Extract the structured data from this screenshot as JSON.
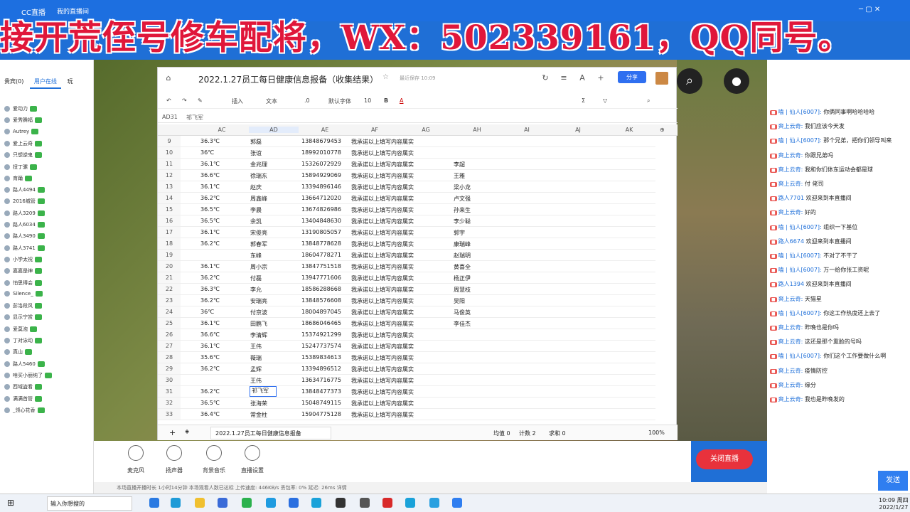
{
  "app": {
    "title": "CC直播",
    "tab1": "我的直播间",
    "banner": "接开荒侄号修车配将，WX：502339161，QQ同号。"
  },
  "left_panel": {
    "tabs": [
      "贵宾(0)",
      "用户在线",
      "玩"
    ],
    "users": [
      "爱动力",
      "爱秀腾福",
      "Autrey",
      "爱上云奇",
      "只想逆鬼",
      "扭丁骡",
      "育踊",
      "路人4494",
      "2016城管",
      "路人3209",
      "路人6034",
      "路人3490",
      "路人3741",
      "小学太祝",
      "嘉嘉是神",
      "怕思得会",
      "Silence_",
      "彭洛段风",
      "显示宁赏",
      "爱莫泡",
      "丁对泳动",
      "真山",
      "路人5460",
      "啥买小丽纯了",
      "西域盗看",
      "满满首管",
      "_领心花香"
    ]
  },
  "sheet": {
    "title": "2022.1.27员工每日健康信息报备（收集结果）",
    "share": "分享",
    "saved": "最近保存 10:09",
    "cell_ref": "AD31",
    "formula": "祁飞军",
    "toolbar": [
      "插入",
      "文本",
      ".0",
      "默认字体",
      "10",
      "B",
      "A"
    ],
    "columns": [
      "AC",
      "AD",
      "AE",
      "AF",
      "AG",
      "AH",
      "AI",
      "AJ",
      "AK"
    ],
    "rows": [
      {
        "n": "9",
        "temp": "36.3℃",
        "name": "郭磊",
        "phone": "13848679453",
        "note": "我承诺以上填写内容属实",
        "ah": ""
      },
      {
        "n": "10",
        "temp": "36℃",
        "name": "张谊",
        "phone": "18992010778",
        "note": "我承诺以上填写内容属实",
        "ah": ""
      },
      {
        "n": "11",
        "temp": "36.1℃",
        "name": "金兆理",
        "phone": "15326072929",
        "note": "我承诺以上填写内容属实",
        "ah": "李超"
      },
      {
        "n": "12",
        "temp": "36.6℃",
        "name": "徐瑞东",
        "phone": "15894929069",
        "note": "我承诺以上填写内容属实",
        "ah": "王雅"
      },
      {
        "n": "13",
        "temp": "36.1℃",
        "name": "赵庆",
        "phone": "13394896146",
        "note": "我承诺以上填写内容属实",
        "ah": "梁小龙"
      },
      {
        "n": "14",
        "temp": "36.2℃",
        "name": "周鑫峰",
        "phone": "13664712020",
        "note": "我承诺以上填写内容属实",
        "ah": "卢文强"
      },
      {
        "n": "15",
        "temp": "36.5℃",
        "name": "李晨",
        "phone": "13674826986",
        "note": "我承诺以上填写内容属实",
        "ah": "孙来生"
      },
      {
        "n": "16",
        "temp": "36.5℃",
        "name": "余凯",
        "phone": "13404848630",
        "note": "我承诺以上填写内容属实",
        "ah": "李少聪"
      },
      {
        "n": "17",
        "temp": "36.1℃",
        "name": "宋俊亮",
        "phone": "13190805057",
        "note": "我承诺以上填写内容属实",
        "ah": "郭宇"
      },
      {
        "n": "18",
        "temp": "36.2℃",
        "name": "郭春军",
        "phone": "13848778628",
        "note": "我承诺以上填写内容属实",
        "ah": "康瑞峰"
      },
      {
        "n": "19",
        "temp": "",
        "name": "东峰",
        "phone": "18604778271",
        "note": "我承诺以上填写内容属实",
        "ah": "赵瑞明"
      },
      {
        "n": "20",
        "temp": "36.1℃",
        "name": "周小宗",
        "phone": "13847751518",
        "note": "我承诺以上填写内容属实",
        "ah": "黄喜全"
      },
      {
        "n": "21",
        "temp": "36.2℃",
        "name": "付磊",
        "phone": "13947771606",
        "note": "我承诺以上填写内容属实",
        "ah": "杨正伊"
      },
      {
        "n": "22",
        "temp": "36.3℃",
        "name": "李允",
        "phone": "18586288668",
        "note": "我承诺以上填写内容属实",
        "ah": "周慧枝"
      },
      {
        "n": "23",
        "temp": "36.2℃",
        "name": "安瑞亮",
        "phone": "13848576608",
        "note": "我承诺以上填写内容属实",
        "ah": "吴阳"
      },
      {
        "n": "24",
        "temp": "36℃",
        "name": "付京波",
        "phone": "18004897045",
        "note": "我承诺以上填写内容属实",
        "ah": "马俊英"
      },
      {
        "n": "25",
        "temp": "36.1℃",
        "name": "田鹏飞",
        "phone": "18686046465",
        "note": "我承诺以上填写内容属实",
        "ah": "李佳杰"
      },
      {
        "n": "26",
        "temp": "36.6℃",
        "name": "李清辉",
        "phone": "15374921299",
        "note": "我承诺以上填写内容属实",
        "ah": ""
      },
      {
        "n": "27",
        "temp": "36.1℃",
        "name": "王伟",
        "phone": "15247737574",
        "note": "我承诺以上填写内容属实",
        "ah": ""
      },
      {
        "n": "28",
        "temp": "35.6℃",
        "name": "薇瑞",
        "phone": "15389834613",
        "note": "我承诺以上填写内容属实",
        "ah": ""
      },
      {
        "n": "29",
        "temp": "36.2℃",
        "name": "孟辉",
        "phone": "13394896512",
        "note": "我承诺以上填写内容属实",
        "ah": ""
      },
      {
        "n": "30",
        "temp": "",
        "name": "王伟",
        "phone": "13634716775",
        "note": "我承诺以上填写内容属实",
        "ah": ""
      },
      {
        "n": "31",
        "temp": "36.2℃",
        "name": "祁飞军",
        "phone": "13848477373",
        "note": "我承诺以上填写内容属实",
        "ah": ""
      },
      {
        "n": "32",
        "temp": "36.5℃",
        "name": "张海荣",
        "phone": "15048749115",
        "note": "我承诺以上填写内容属实",
        "ah": ""
      },
      {
        "n": "33",
        "temp": "36.4℃",
        "name": "常金柱",
        "phone": "15904775128",
        "note": "我承诺以上填写内容属实",
        "ah": ""
      }
    ],
    "sheet_tab": "2022.1.27员工每日健康信息报备",
    "bottom_stats": [
      "均值 0",
      "计数 2",
      "求和 0"
    ],
    "zoom": "100%"
  },
  "chat": {
    "messages": [
      {
        "user": "嗑 | 仙人[6007]:",
        "text": "你俩同事啊哈哈哈哈"
      },
      {
        "user": "爽上云奇:",
        "text": "我们应该今天发"
      },
      {
        "user": "嗑 | 仙人[6007]:",
        "text": "那个兄弟，把你们领导叫来"
      },
      {
        "user": "爽上云奇:",
        "text": "你跟兄弟吗"
      },
      {
        "user": "爽上云奇:",
        "text": "我和你们体东运动会都是球"
      },
      {
        "user": "爽上云奇:",
        "text": "付 佬司"
      },
      {
        "user": "路人7701",
        "text": "欢迎来到本直播间"
      },
      {
        "user": "爽上云奇:",
        "text": "好的"
      },
      {
        "user": "嗑 | 仙人[6007]:",
        "text": "组织一下基位"
      },
      {
        "user": "路人6674",
        "text": "欢迎来到本直播间"
      },
      {
        "user": "嗑 | 仙人[6007]:",
        "text": "不对了不干了"
      },
      {
        "user": "嗑 | 仙人[6007]:",
        "text": "万一给你张工资呢"
      },
      {
        "user": "路人1394",
        "text": "欢迎来到本直播间"
      },
      {
        "user": "爽上云奇:",
        "text": "天猫星"
      },
      {
        "user": "嗑 | 仙人[6007]:",
        "text": "你这工作热度还上去了"
      },
      {
        "user": "爽上云奇:",
        "text": "昨晚也是你吗"
      },
      {
        "user": "爽上云奇:",
        "text": "这还是那个熏脸的号吗"
      },
      {
        "user": "嗑 | 仙人[6007]:",
        "text": "你们这个工作要做什么啊"
      },
      {
        "user": "爽上云奇:",
        "text": "疫情防控"
      },
      {
        "user": "爽上云奇:",
        "text": "缘分"
      },
      {
        "user": "爽上云奇:",
        "text": "我也是昨晚发的"
      }
    ],
    "close_live": "关闭直播",
    "send": "发送"
  },
  "controls": {
    "items": [
      "麦克风",
      "扬声器",
      "背景音乐",
      "直播设置"
    ],
    "status": "本场直播开播时长 1小时14分钟  本场观看人数已达标  上传速度: 446KB/s  丢包率: 0%  延迟: 26ms  详情"
  },
  "taskbar": {
    "search": "输入你想搜的",
    "time": "10:09 周四",
    "date": "2022/1/27"
  }
}
